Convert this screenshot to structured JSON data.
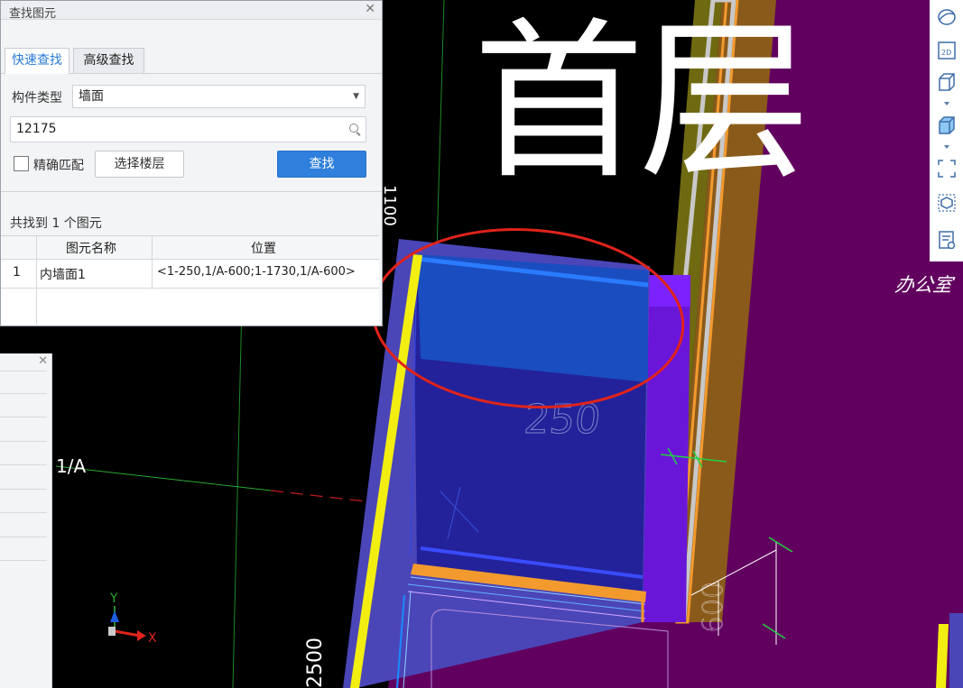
{
  "dialog": {
    "title": "查找图元",
    "tabs": [
      "快速查找",
      "高级查找"
    ],
    "component_type_label": "构件类型",
    "component_type_value": "墙面",
    "search_value": "12175",
    "exact_match_label": "精确匹配",
    "select_floor_button": "选择楼层",
    "find_button": "查找",
    "result_summary": "共找到 1 个图元",
    "table": {
      "headers": [
        "图元名称",
        "位置"
      ],
      "rows": [
        {
          "index": "1",
          "name": "内墙面1",
          "position": "<1-250,1/A-600;1-1730,1/A-600>"
        }
      ]
    }
  },
  "viewport": {
    "floor_label": "首层",
    "room_label": "办公室",
    "dimensions": [
      "250",
      "600",
      "2500",
      "1100"
    ],
    "axis_label": "1/A",
    "axis_x": "X",
    "axis_y": "Y"
  },
  "toolbar": {
    "icons": [
      "orbit-icon",
      "2d-view-icon",
      "3d-box-outline-icon",
      "3d-box-filled-icon",
      "fullscreen-icon",
      "element-view-icon",
      "display-settings-icon"
    ],
    "view_2d_text": "2D"
  },
  "colors": {
    "background": "#000000",
    "floor_slab": "#62005f",
    "selected_wall": "#1a4dbf",
    "highlight_ellipse": "#e0231b",
    "accent_blue": "#2f7fdc"
  }
}
